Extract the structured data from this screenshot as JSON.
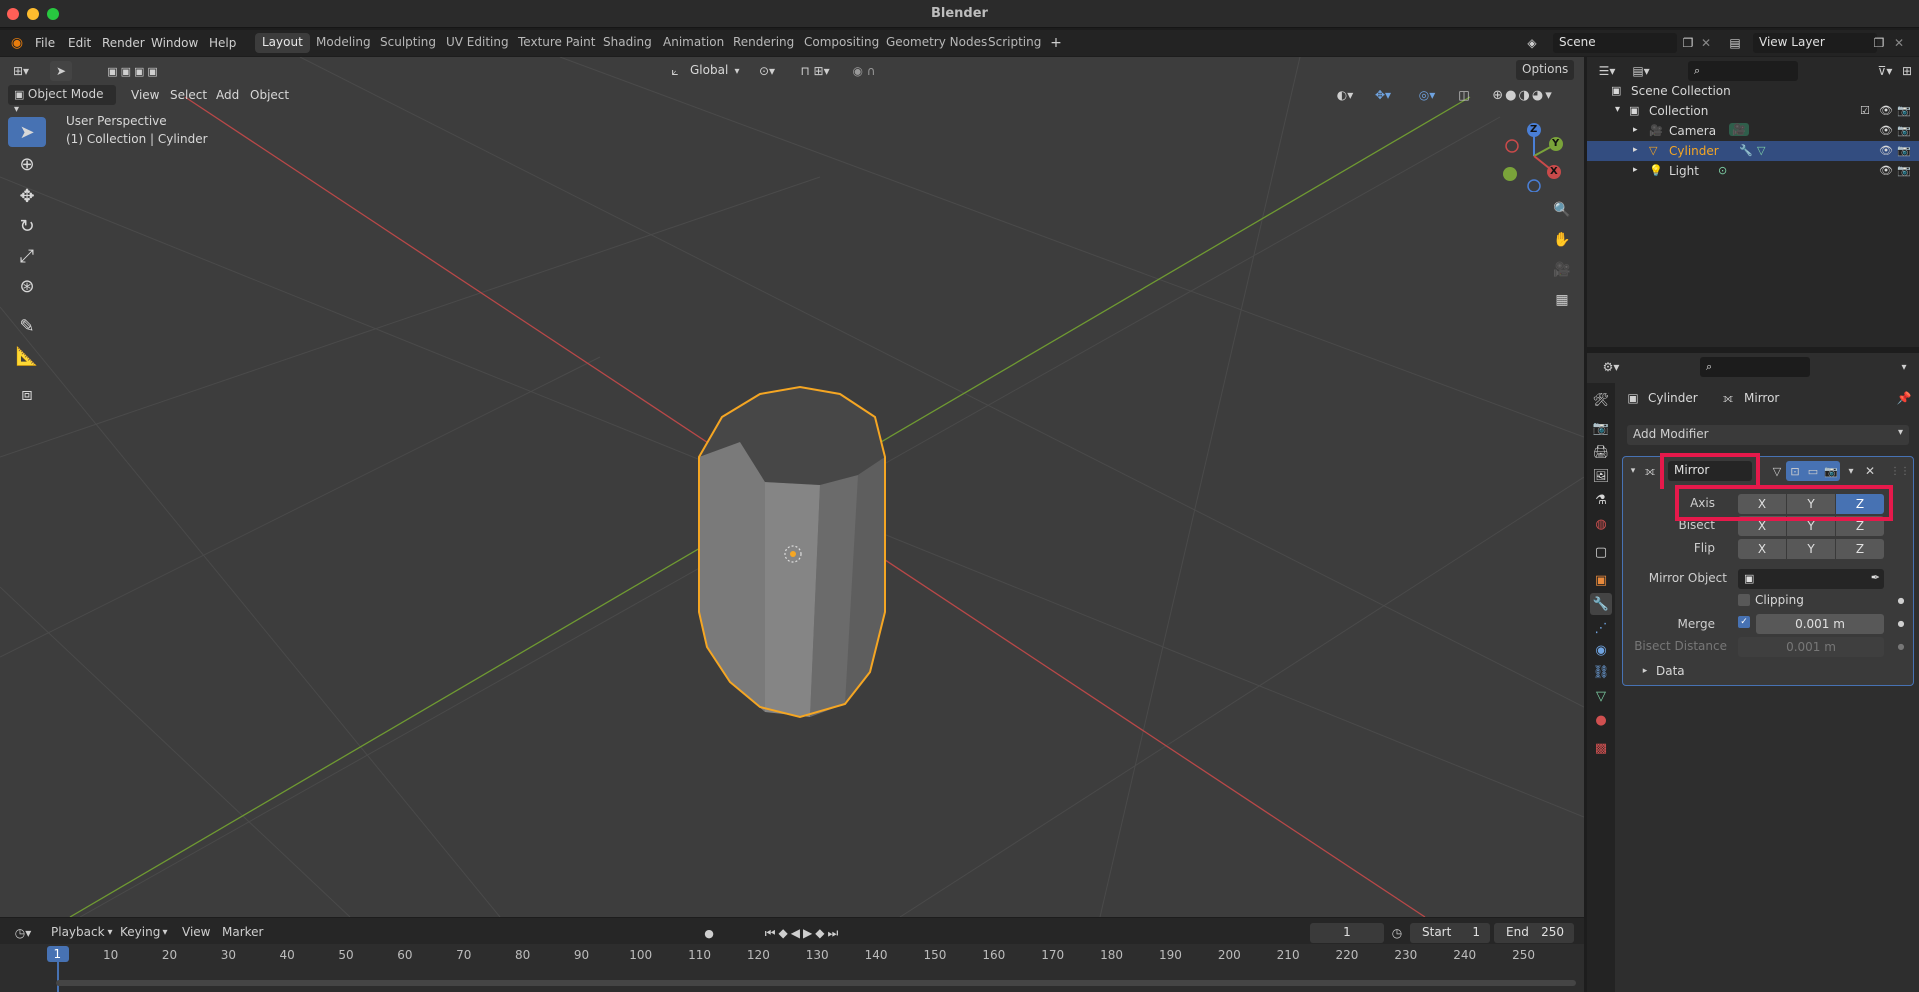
{
  "window": {
    "title": "Blender"
  },
  "menus": [
    "File",
    "Edit",
    "Render",
    "Window",
    "Help"
  ],
  "workspaces": [
    "Layout",
    "Modeling",
    "Sculpting",
    "UV Editing",
    "Texture Paint",
    "Shading",
    "Animation",
    "Rendering",
    "Compositing",
    "Geometry Nodes",
    "Scripting"
  ],
  "active_workspace": "Layout",
  "scene": {
    "name": "Scene",
    "view_layer": "View Layer"
  },
  "viewport": {
    "mode": "Object Mode",
    "menus": [
      "View",
      "Select",
      "Add",
      "Object"
    ],
    "orientation": "Global",
    "options_label": "Options",
    "perspective_label": "User Perspective",
    "context_label": "(1) Collection | Cylinder",
    "gizmo": {
      "x": "X",
      "y": "Y",
      "z": "Z"
    }
  },
  "timeline": {
    "menus": [
      "Playback",
      "Keying",
      "View",
      "Marker"
    ],
    "current_frame": "1",
    "start_label": "Start",
    "start_value": "1",
    "end_label": "End",
    "end_value": "250",
    "ticks": [
      "1",
      "10",
      "20",
      "30",
      "40",
      "50",
      "60",
      "70",
      "80",
      "90",
      "100",
      "110",
      "120",
      "130",
      "140",
      "150",
      "160",
      "170",
      "180",
      "190",
      "200",
      "210",
      "220",
      "230",
      "240",
      "250"
    ]
  },
  "outliner": {
    "root": "Scene Collection",
    "collection": "Collection",
    "items": [
      "Camera",
      "Cylinder",
      "Light"
    ],
    "selected": "Cylinder"
  },
  "properties": {
    "breadcrumb_object": "Cylinder",
    "breadcrumb_modifier": "Mirror",
    "add_modifier": "Add Modifier",
    "modifier_name": "Mirror",
    "axis_label": "Axis",
    "bisect_label": "Bisect",
    "flip_label": "Flip",
    "xyz": [
      "X",
      "Y",
      "Z"
    ],
    "axis_active": "Z",
    "mirror_object_label": "Mirror Object",
    "clipping_label": "Clipping",
    "merge_label": "Merge",
    "merge_value": "0.001 m",
    "bisect_distance_label": "Bisect Distance",
    "bisect_distance_value": "0.001 m",
    "data_label": "Data"
  },
  "colors": {
    "accent": "#4772b3",
    "selection_outline": "#f5a623",
    "x_axis": "#c94a4a",
    "y_axis": "#7aa33a",
    "highlight": "#e6194b"
  }
}
